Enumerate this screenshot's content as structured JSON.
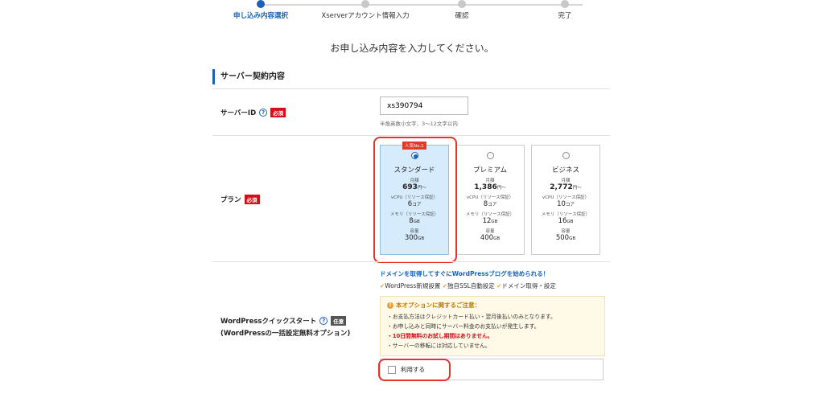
{
  "stepper": {
    "steps": [
      {
        "label": "申し込み内容選択",
        "active": true
      },
      {
        "label": "Xserverアカウント情報入力",
        "active": false
      },
      {
        "label": "確認",
        "active": false
      },
      {
        "label": "完了",
        "active": false
      }
    ]
  },
  "page_heading": "お申し込み内容を入力してください。",
  "section_title": "サーバー契約内容",
  "server_id": {
    "label": "サーバーID",
    "required": "必須",
    "help": "?",
    "value": "xs390794",
    "hint": "半角英数小文字、3〜12文字以内"
  },
  "plan": {
    "label": "プラン",
    "required": "必須",
    "popular_badge": "人気No.1",
    "options": [
      {
        "name": "スタンダード",
        "price_label": "月額",
        "price": "693",
        "price_unit": "円〜",
        "cpu_label": "vCPU（リソース保証）",
        "cpu": "6",
        "cpu_unit": "コア",
        "mem_label": "メモリ（リソース保証）",
        "mem": "8",
        "mem_unit": "GB",
        "disk_label": "容量",
        "disk": "300",
        "disk_unit": "GB",
        "selected": true
      },
      {
        "name": "プレミアム",
        "price_label": "月額",
        "price": "1,386",
        "price_unit": "円〜",
        "cpu_label": "vCPU（リソース保証）",
        "cpu": "8",
        "cpu_unit": "コア",
        "mem_label": "メモリ（リソース保証）",
        "mem": "12",
        "mem_unit": "GB",
        "disk_label": "容量",
        "disk": "400",
        "disk_unit": "GB",
        "selected": false
      },
      {
        "name": "ビジネス",
        "price_label": "月額",
        "price": "2,772",
        "price_unit": "円〜",
        "cpu_label": "vCPU（リソース保証）",
        "cpu": "10",
        "cpu_unit": "コア",
        "mem_label": "メモリ（リソース保証）",
        "mem": "16",
        "mem_unit": "GB",
        "disk_label": "容量",
        "disk": "500",
        "disk_unit": "GB",
        "selected": false
      }
    ]
  },
  "wordpress": {
    "label": "WordPressクイックスタート",
    "help": "?",
    "optional": "任意",
    "sublabel": "(WordPressの一括設定無料オプション)",
    "intro": "ドメインを取得してすぐにWordPressブログを始められる！",
    "features": [
      "WordPress新規設置",
      "独自SSL自動設定",
      "ドメイン取得・設定"
    ],
    "check_glyph": "✔",
    "notice_title": "本オプションに関するご注意：",
    "notice_items": [
      "お支払方法はクレジットカード払い・翌月後払いのみとなります。",
      "お申し込みと同時にサーバー料金のお支払いが発生します。",
      "10日間無料のお試し期間はありません。",
      "サーバーの移転には対応していません。"
    ],
    "use_label": "利用する"
  },
  "colors": {
    "accent": "#1a62b8",
    "required": "#d0101b",
    "highlight": "#e4332b"
  }
}
